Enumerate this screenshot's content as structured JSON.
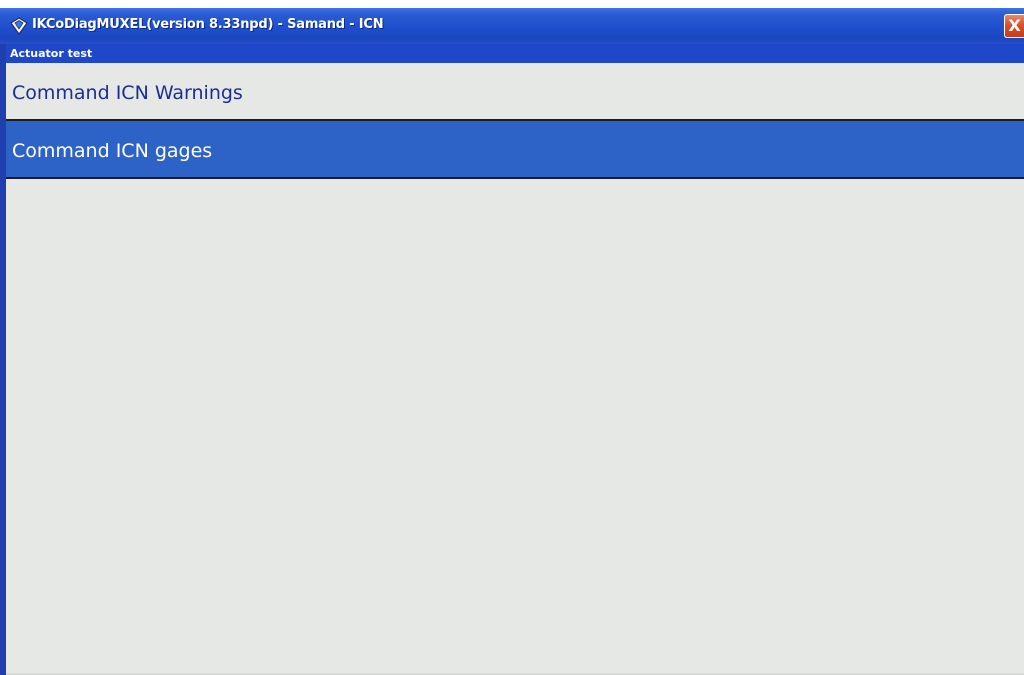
{
  "window": {
    "title": "IKCoDiagMUXEL(version 8.33npd) - Samand - ICN",
    "app_icon": "diagnostic-app-icon",
    "close_label": "X"
  },
  "section": {
    "title": "Actuator test"
  },
  "menu": {
    "items": [
      {
        "label": "Command ICN Warnings",
        "selected": false
      },
      {
        "label": "Command ICN gages",
        "selected": true
      }
    ]
  },
  "colors": {
    "titlebar": "#1f4fcd",
    "section_bar": "#1e48c9",
    "selected_item": "#2d63c7",
    "item_text": "#1a2f96",
    "background": "#e6e8e6"
  }
}
